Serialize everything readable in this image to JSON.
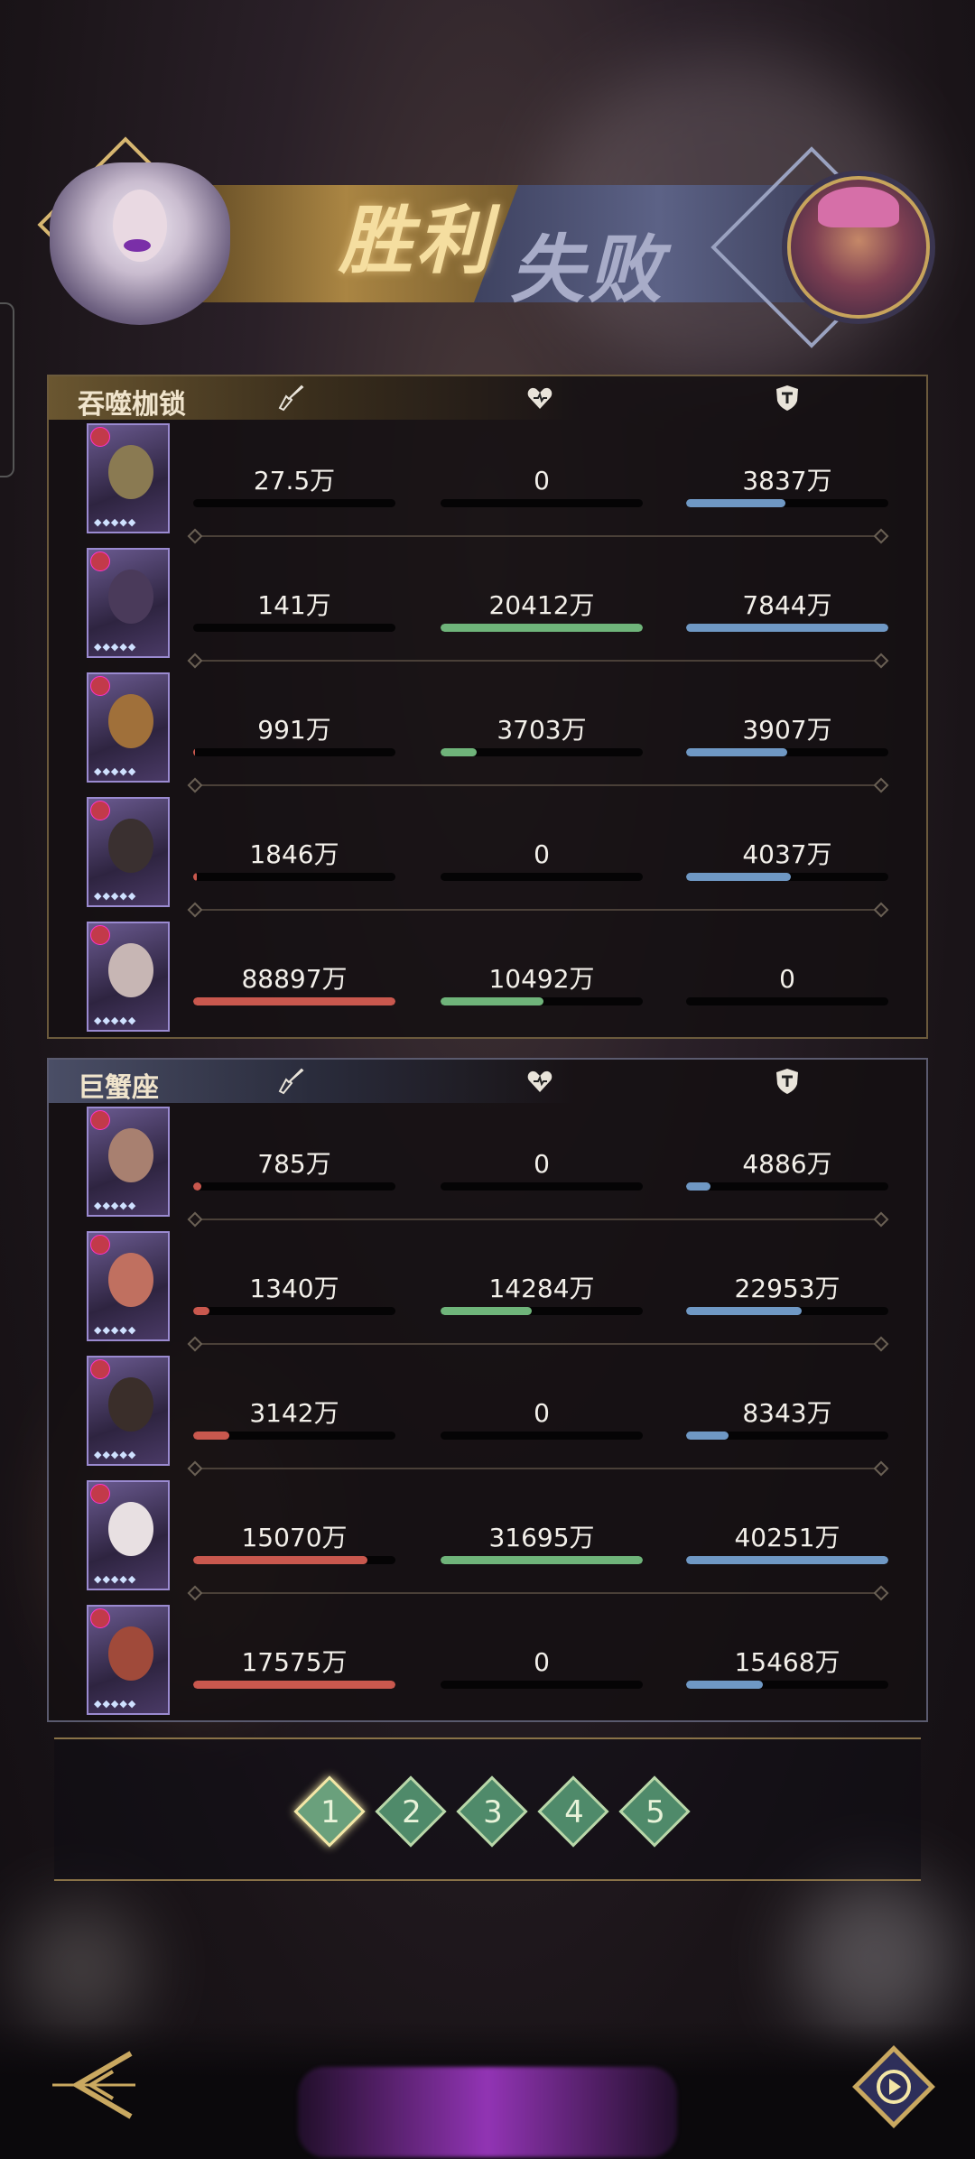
{
  "header": {
    "victory_text": "胜利",
    "defeat_text": "失败"
  },
  "teams": [
    {
      "name": "吞噬枷锁",
      "members": [
        {
          "damage": "27.5万",
          "damage_frac": 0.0,
          "heal": "0",
          "heal_frac": 0.0,
          "tank": "3837万",
          "tank_frac": 0.49,
          "face": "#8a7a52"
        },
        {
          "damage": "141万",
          "damage_frac": 0.0,
          "heal": "20412万",
          "heal_frac": 1.0,
          "tank": "7844万",
          "tank_frac": 1.0,
          "face": "#4a3a5a"
        },
        {
          "damage": "991万",
          "damage_frac": 0.01,
          "heal": "3703万",
          "heal_frac": 0.18,
          "tank": "3907万",
          "tank_frac": 0.5,
          "face": "#a0703a"
        },
        {
          "damage": "1846万",
          "damage_frac": 0.02,
          "heal": "0",
          "heal_frac": 0.0,
          "tank": "4037万",
          "tank_frac": 0.52,
          "face": "#3a3030"
        },
        {
          "damage": "88897万",
          "damage_frac": 1.0,
          "heal": "10492万",
          "heal_frac": 0.51,
          "tank": "0",
          "tank_frac": 0.0,
          "face": "#c7b6b4"
        }
      ]
    },
    {
      "name": "巨蟹座",
      "members": [
        {
          "damage": "785万",
          "damage_frac": 0.04,
          "heal": "0",
          "heal_frac": 0.0,
          "tank": "4886万",
          "tank_frac": 0.12,
          "face": "#a88070"
        },
        {
          "damage": "1340万",
          "damage_frac": 0.08,
          "heal": "14284万",
          "heal_frac": 0.45,
          "tank": "22953万",
          "tank_frac": 0.57,
          "face": "#c07060"
        },
        {
          "damage": "3142万",
          "damage_frac": 0.18,
          "heal": "0",
          "heal_frac": 0.0,
          "tank": "8343万",
          "tank_frac": 0.21,
          "face": "#3a2e2a"
        },
        {
          "damage": "15070万",
          "damage_frac": 0.86,
          "heal": "31695万",
          "heal_frac": 1.0,
          "tank": "40251万",
          "tank_frac": 1.0,
          "face": "#e8e0e2"
        },
        {
          "damage": "17575万",
          "damage_frac": 1.0,
          "heal": "0",
          "heal_frac": 0.0,
          "tank": "15468万",
          "tank_frac": 0.38,
          "face": "#a04a3a"
        }
      ]
    }
  ],
  "pager": {
    "pages": [
      "1",
      "2",
      "3",
      "4",
      "5"
    ],
    "active": 0
  },
  "colors": {
    "damage": "#c9584e",
    "heal": "#6fb47a",
    "tank": "#6f98c4"
  },
  "icons": {
    "damage": "sword-icon",
    "heal": "heart-icon",
    "tank": "shield-icon",
    "back": "back-arrow-icon",
    "replay": "replay-icon"
  }
}
